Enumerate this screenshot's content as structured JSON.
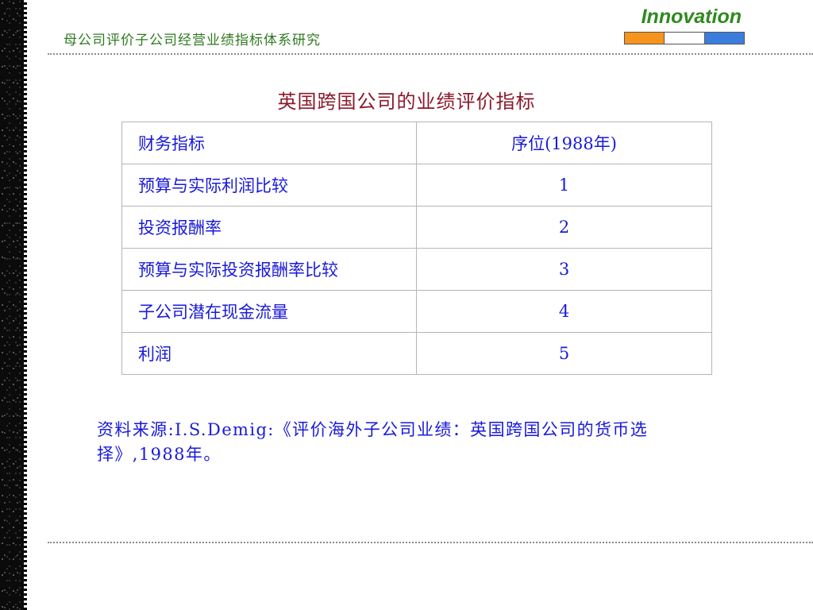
{
  "header": {
    "title": "母公司评价子公司经营业绩指标体系研究"
  },
  "logo": {
    "text": "Innovation",
    "swatch_colors": [
      "#f7941d",
      "#ffffff",
      "#3b7ddd"
    ]
  },
  "slide": {
    "title": "英国跨国公司的业绩评价指标"
  },
  "table": {
    "headers": [
      "财务指标",
      "序位(1988年)"
    ],
    "rows": [
      {
        "indicator": "预算与实际利润比较",
        "rank": "1"
      },
      {
        "indicator": "投资报酬率",
        "rank": "2"
      },
      {
        "indicator": "预算与实际投资报酬率比较",
        "rank": "3"
      },
      {
        "indicator": "子公司潜在现金流量",
        "rank": "4"
      },
      {
        "indicator": "利润",
        "rank": "5"
      }
    ]
  },
  "source": {
    "text": "资料来源:I.S.Demig:《评价海外子公司业绩：英国跨国公司的货币选择》,1988年。"
  }
}
